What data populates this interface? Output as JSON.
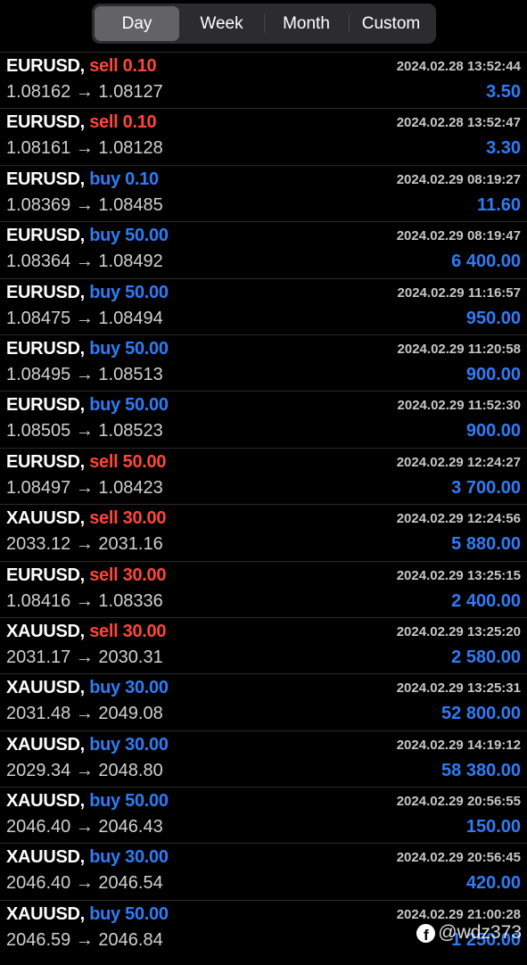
{
  "tabs": [
    {
      "label": "Day",
      "active": true
    },
    {
      "label": "Week",
      "active": false
    },
    {
      "label": "Month",
      "active": false
    },
    {
      "label": "Custom",
      "active": false
    }
  ],
  "colors": {
    "sell": "#ff453a",
    "buy": "#2f7cf6",
    "background": "#000000"
  },
  "trades": [
    {
      "symbol": "EURUSD,",
      "side": "sell",
      "volume": "0.10",
      "open": "1.08162",
      "close": "1.08127",
      "time": "2024.02.28 13:52:44",
      "profit": "3.50"
    },
    {
      "symbol": "EURUSD,",
      "side": "sell",
      "volume": "0.10",
      "open": "1.08161",
      "close": "1.08128",
      "time": "2024.02.28 13:52:47",
      "profit": "3.30"
    },
    {
      "symbol": "EURUSD,",
      "side": "buy",
      "volume": "0.10",
      "open": "1.08369",
      "close": "1.08485",
      "time": "2024.02.29 08:19:27",
      "profit": "11.60"
    },
    {
      "symbol": "EURUSD,",
      "side": "buy",
      "volume": "50.00",
      "open": "1.08364",
      "close": "1.08492",
      "time": "2024.02.29 08:19:47",
      "profit": "6 400.00"
    },
    {
      "symbol": "EURUSD,",
      "side": "buy",
      "volume": "50.00",
      "open": "1.08475",
      "close": "1.08494",
      "time": "2024.02.29 11:16:57",
      "profit": "950.00"
    },
    {
      "symbol": "EURUSD,",
      "side": "buy",
      "volume": "50.00",
      "open": "1.08495",
      "close": "1.08513",
      "time": "2024.02.29 11:20:58",
      "profit": "900.00"
    },
    {
      "symbol": "EURUSD,",
      "side": "buy",
      "volume": "50.00",
      "open": "1.08505",
      "close": "1.08523",
      "time": "2024.02.29 11:52:30",
      "profit": "900.00"
    },
    {
      "symbol": "EURUSD,",
      "side": "sell",
      "volume": "50.00",
      "open": "1.08497",
      "close": "1.08423",
      "time": "2024.02.29 12:24:27",
      "profit": "3 700.00"
    },
    {
      "symbol": "XAUUSD,",
      "side": "sell",
      "volume": "30.00",
      "open": "2033.12",
      "close": "2031.16",
      "time": "2024.02.29 12:24:56",
      "profit": "5 880.00"
    },
    {
      "symbol": "EURUSD,",
      "side": "sell",
      "volume": "30.00",
      "open": "1.08416",
      "close": "1.08336",
      "time": "2024.02.29 13:25:15",
      "profit": "2 400.00"
    },
    {
      "symbol": "XAUUSD,",
      "side": "sell",
      "volume": "30.00",
      "open": "2031.17",
      "close": "2030.31",
      "time": "2024.02.29 13:25:20",
      "profit": "2 580.00"
    },
    {
      "symbol": "XAUUSD,",
      "side": "buy",
      "volume": "30.00",
      "open": "2031.48",
      "close": "2049.08",
      "time": "2024.02.29 13:25:31",
      "profit": "52 800.00"
    },
    {
      "symbol": "XAUUSD,",
      "side": "buy",
      "volume": "30.00",
      "open": "2029.34",
      "close": "2048.80",
      "time": "2024.02.29 14:19:12",
      "profit": "58 380.00"
    },
    {
      "symbol": "XAUUSD,",
      "side": "buy",
      "volume": "50.00",
      "open": "2046.40",
      "close": "2046.43",
      "time": "2024.02.29 20:56:55",
      "profit": "150.00"
    },
    {
      "symbol": "XAUUSD,",
      "side": "buy",
      "volume": "30.00",
      "open": "2046.40",
      "close": "2046.54",
      "time": "2024.02.29 20:56:45",
      "profit": "420.00"
    },
    {
      "symbol": "XAUUSD,",
      "side": "buy",
      "volume": "50.00",
      "open": "2046.59",
      "close": "2046.84",
      "time": "2024.02.29 21:00:28",
      "profit": "1 250.00"
    }
  ],
  "arrow": "→",
  "watermark": {
    "icon": "facebook-icon",
    "text": "@wdz373"
  }
}
